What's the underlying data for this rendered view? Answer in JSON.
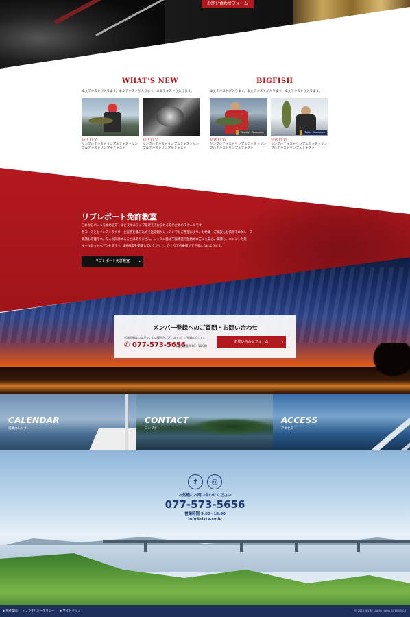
{
  "hero": {
    "button_label": "お問い合わせフォーム"
  },
  "whats_new": {
    "title": "WHAT'S NEW",
    "description": "本文テキストが入ります。本文テキストが入ります。本文テキストが入ります。",
    "cards": [
      {
        "date": "2015.11.30",
        "text": "サンプルテキストサンプルテキストサンプルテキストサンプルテキスト"
      },
      {
        "date": "2015.11.30",
        "text": "サンプルテキストサンプルテキストサンプルテキストサンプルテキスト"
      }
    ]
  },
  "bigfish": {
    "title": "BIGFISH",
    "description": "本文テキストが入ります。本文テキストが入ります。本文テキストが入ります。",
    "cards": [
      {
        "date": "2015.11.30",
        "badge": "Monthly Champion",
        "text": "サンプルテキストサンプルテキストサンプルテキストサンプルテキスト"
      },
      {
        "date": "2015.11.30",
        "badge": "Today Champion",
        "text": "サンプルテキストサンプルテキストサンプルテキストサンプルテキスト"
      }
    ]
  },
  "license": {
    "title": "リブレポート免許教室",
    "p1": "これからボートを始める方、またスキルアップを考えておられる方のためのスクールです。",
    "p2": "各コースともインストラクターと実習を積み込めで送る個人レッスンでもご希望により、お仲間・ご家族もお揃えてのグループ",
    "p3": "受講も可能です。先人が同席することはありません。レッスン艇は不誤構造で独始めの方にも安心。受講も。エンジン付近",
    "p4": "ネールヨットへアクセスです。4分程度を受講していただくと、ひとりでの乗艇ができるようになります。",
    "button_label": "リブレポート免許教室"
  },
  "contact": {
    "title": "メンバー登録へのご質問・お問い合わせ",
    "note": "営業時間はつながりにくい場合がございますが、ご連絡ください。",
    "phone": "077-573-5656",
    "hours": "(受付時間 9:00～18:00)",
    "button_label": "お問い合わせフォーム"
  },
  "panels": [
    {
      "en": "CALENDAR",
      "jp": "営業カレンダー"
    },
    {
      "en": "CONTACT",
      "jp": "コンタクト"
    },
    {
      "en": "ACCESS",
      "jp": "アクセス"
    }
  ],
  "footer": {
    "social": [
      "f",
      "◎"
    ],
    "message": "お気軽にお問い合わせください",
    "phone": "077-573-5656",
    "hours": "営業時間 9:00~18:00",
    "email": "info@rivre.co.jp",
    "links": [
      "会社案内",
      "プライバシーポリシー",
      "サイトマップ"
    ],
    "copyright": "© 2015 RIVRE Ltd.All rights 2015.03.03"
  },
  "colors": {
    "brand_red": "#b0191e",
    "navy": "#1e2f5e"
  }
}
